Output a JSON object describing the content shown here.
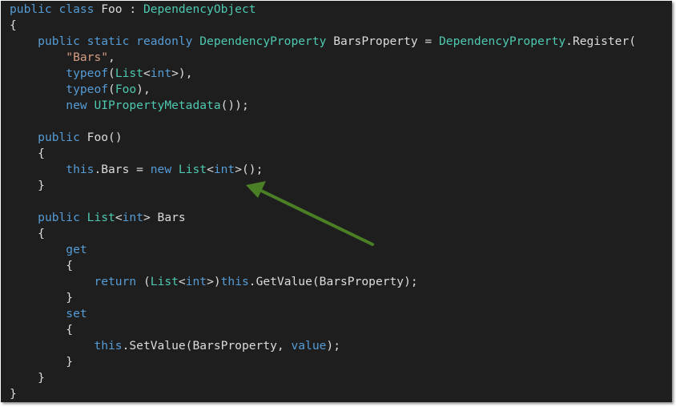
{
  "colors": {
    "background": "#1e1e1e",
    "keyword": "#569cd6",
    "type": "#4ec9b0",
    "string": "#d69d85",
    "text": "#dcdcdc",
    "annotation_arrow": "#4a7f25"
  },
  "annotation": {
    "icon": "arrow-icon",
    "points_to_line": 11
  },
  "code": {
    "lines": [
      [
        {
          "t": "kw",
          "v": "public class "
        },
        {
          "t": "tx",
          "v": "Foo : "
        },
        {
          "t": "ty",
          "v": "DependencyObject"
        }
      ],
      [
        {
          "t": "tx",
          "v": "{"
        }
      ],
      [
        {
          "t": "tx",
          "v": "    "
        },
        {
          "t": "kw",
          "v": "public static readonly "
        },
        {
          "t": "ty",
          "v": "DependencyProperty"
        },
        {
          "t": "tx",
          "v": " BarsProperty = "
        },
        {
          "t": "ty",
          "v": "DependencyProperty"
        },
        {
          "t": "tx",
          "v": ".Register("
        }
      ],
      [
        {
          "t": "tx",
          "v": "        "
        },
        {
          "t": "str",
          "v": "\"Bars\""
        },
        {
          "t": "tx",
          "v": ","
        }
      ],
      [
        {
          "t": "tx",
          "v": "        "
        },
        {
          "t": "kw",
          "v": "typeof"
        },
        {
          "t": "tx",
          "v": "("
        },
        {
          "t": "ty",
          "v": "List"
        },
        {
          "t": "tx",
          "v": "<"
        },
        {
          "t": "kw",
          "v": "int"
        },
        {
          "t": "tx",
          "v": ">),"
        }
      ],
      [
        {
          "t": "tx",
          "v": "        "
        },
        {
          "t": "kw",
          "v": "typeof"
        },
        {
          "t": "tx",
          "v": "("
        },
        {
          "t": "ty",
          "v": "Foo"
        },
        {
          "t": "tx",
          "v": "),"
        }
      ],
      [
        {
          "t": "tx",
          "v": "        "
        },
        {
          "t": "kw",
          "v": "new "
        },
        {
          "t": "ty",
          "v": "UIPropertyMetadata"
        },
        {
          "t": "tx",
          "v": "());"
        }
      ],
      [],
      [
        {
          "t": "tx",
          "v": "    "
        },
        {
          "t": "kw",
          "v": "public "
        },
        {
          "t": "tx",
          "v": "Foo()"
        }
      ],
      [
        {
          "t": "tx",
          "v": "    {"
        }
      ],
      [
        {
          "t": "tx",
          "v": "        "
        },
        {
          "t": "kw",
          "v": "this"
        },
        {
          "t": "tx",
          "v": ".Bars = "
        },
        {
          "t": "kw",
          "v": "new "
        },
        {
          "t": "ty",
          "v": "List"
        },
        {
          "t": "tx",
          "v": "<"
        },
        {
          "t": "kw",
          "v": "int"
        },
        {
          "t": "tx",
          "v": ">();"
        }
      ],
      [
        {
          "t": "tx",
          "v": "    }"
        }
      ],
      [],
      [
        {
          "t": "tx",
          "v": "    "
        },
        {
          "t": "kw",
          "v": "public "
        },
        {
          "t": "ty",
          "v": "List"
        },
        {
          "t": "tx",
          "v": "<"
        },
        {
          "t": "kw",
          "v": "int"
        },
        {
          "t": "tx",
          "v": "> Bars"
        }
      ],
      [
        {
          "t": "tx",
          "v": "    {"
        }
      ],
      [
        {
          "t": "tx",
          "v": "        "
        },
        {
          "t": "kw",
          "v": "get"
        }
      ],
      [
        {
          "t": "tx",
          "v": "        {"
        }
      ],
      [
        {
          "t": "tx",
          "v": "            "
        },
        {
          "t": "kw",
          "v": "return "
        },
        {
          "t": "tx",
          "v": "("
        },
        {
          "t": "ty",
          "v": "List"
        },
        {
          "t": "tx",
          "v": "<"
        },
        {
          "t": "kw",
          "v": "int"
        },
        {
          "t": "tx",
          "v": ">)"
        },
        {
          "t": "kw",
          "v": "this"
        },
        {
          "t": "tx",
          "v": ".GetValue(BarsProperty);"
        }
      ],
      [
        {
          "t": "tx",
          "v": "        }"
        }
      ],
      [
        {
          "t": "tx",
          "v": "        "
        },
        {
          "t": "kw",
          "v": "set"
        }
      ],
      [
        {
          "t": "tx",
          "v": "        {"
        }
      ],
      [
        {
          "t": "tx",
          "v": "            "
        },
        {
          "t": "kw",
          "v": "this"
        },
        {
          "t": "tx",
          "v": ".SetValue(BarsProperty, "
        },
        {
          "t": "kw",
          "v": "value"
        },
        {
          "t": "tx",
          "v": ");"
        }
      ],
      [
        {
          "t": "tx",
          "v": "        }"
        }
      ],
      [
        {
          "t": "tx",
          "v": "    }"
        }
      ],
      [
        {
          "t": "tx",
          "v": "}"
        }
      ]
    ]
  }
}
